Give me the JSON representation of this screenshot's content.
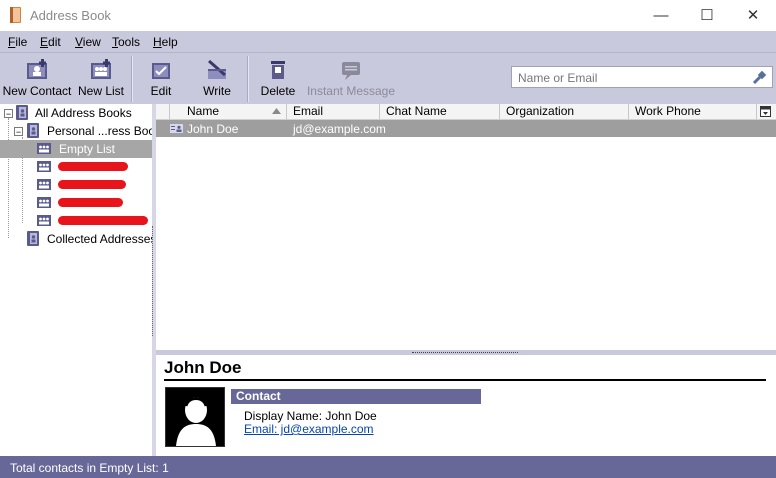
{
  "window": {
    "title": "Address Book",
    "controls": {
      "minimize": "—",
      "maximize": "☐",
      "close": "✕"
    }
  },
  "menu": [
    {
      "label": "File",
      "key": "F",
      "rest": "ile"
    },
    {
      "label": "Edit",
      "key": "E",
      "rest": "dit"
    },
    {
      "label": "View",
      "key": "V",
      "rest": "iew"
    },
    {
      "label": "Tools",
      "key": "T",
      "rest": "ools"
    },
    {
      "label": "Help",
      "key": "H",
      "rest": "elp"
    }
  ],
  "toolbar": {
    "new_contact": "New Contact",
    "new_list": "New List",
    "edit": "Edit",
    "write": "Write",
    "delete": "Delete",
    "instant_message": "Instant Message",
    "search_placeholder": "Name or Email"
  },
  "tree": {
    "all_address_books": "All Address Books",
    "personal": "Personal ...ress Book",
    "empty_list": "Empty List",
    "collected": "Collected Addresses"
  },
  "columns": {
    "name": "Name",
    "email": "Email",
    "chat": "Chat Name",
    "org": "Organization",
    "phone": "Work Phone"
  },
  "contacts": [
    {
      "name": "John Doe",
      "email": "jd@example.com"
    }
  ],
  "detail": {
    "name": "John Doe",
    "section": "Contact",
    "display_name": "Display Name: John Doe",
    "email": "Email: jd@example.com"
  },
  "status": "Total contacts in Empty List: 1",
  "colors": {
    "chrome": "#c9c9dd",
    "accent": "#686898",
    "selection": "#9e9e9e",
    "redaction": "#e8141b"
  }
}
